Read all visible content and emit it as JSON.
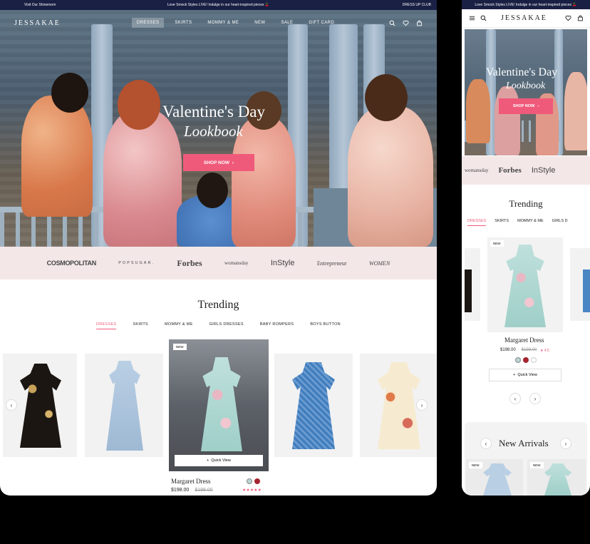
{
  "desktop": {
    "promo": {
      "left": "Visit Our Showroom",
      "center": "Love Smock Styles LIVE! Indulge in our heart-inspired pieces 🍒",
      "right": "DRESS UP CLUB"
    },
    "brand": "JESSAKAE",
    "menu": [
      "DRESSES",
      "SKIRTS",
      "MOMMY & ME",
      "NEW",
      "SALE",
      "GIFT CARD"
    ],
    "hero": {
      "title": "Valentine's Day",
      "subtitle": "Lookbook",
      "cta": "SHOP NOW",
      "cta_arrow": "›"
    },
    "press": [
      "COSMOPOLITAN",
      "POPSUGAR.",
      "Forbes",
      "womansday",
      "InStyle",
      "Entrepreneur",
      "WOMEN"
    ],
    "trending": {
      "title": "Trending",
      "tabs": [
        "DRESSES",
        "SKIRTS",
        "MOMMY & ME",
        "GIRLS DRESSES",
        "BABY ROMPERS",
        "BOYS BUTTON"
      ],
      "featured": {
        "badge": "NEW",
        "quick_view": "Quick View",
        "name": "Margaret Dress",
        "price": "$198.00",
        "old_price": "$198.00",
        "stars": "★★★★★"
      },
      "arrow_left": "‹",
      "arrow_right": "›"
    }
  },
  "mobile": {
    "promo": "Love Smock Styles LIVE! Indulge in our heart-inspired pieces 🍒",
    "brand": "JESSAKAE",
    "hero": {
      "title": "Valentine's Day",
      "subtitle": "Lookbook",
      "cta": "SHOP NOW",
      "cta_arrow": "›"
    },
    "press": [
      "womansday",
      "Forbes",
      "InStyle"
    ],
    "trending": {
      "title": "Trending",
      "tabs": [
        "DRESSES",
        "SKIRTS",
        "MOMMY & ME",
        "GIRLS D"
      ],
      "product": {
        "badge": "NEW",
        "name": "Margaret Dress",
        "price": "$198.00",
        "old_price": "$198.00",
        "rating": "★ 4.5",
        "quick_view": "Quick View"
      }
    },
    "new_arrivals": {
      "title": "New Arrivals",
      "badge": "NEW",
      "badge2": "NEW"
    }
  },
  "colors": {
    "accent": "#f05a7a",
    "navy": "#1a1f44",
    "press_bg": "#f4e7e8"
  }
}
